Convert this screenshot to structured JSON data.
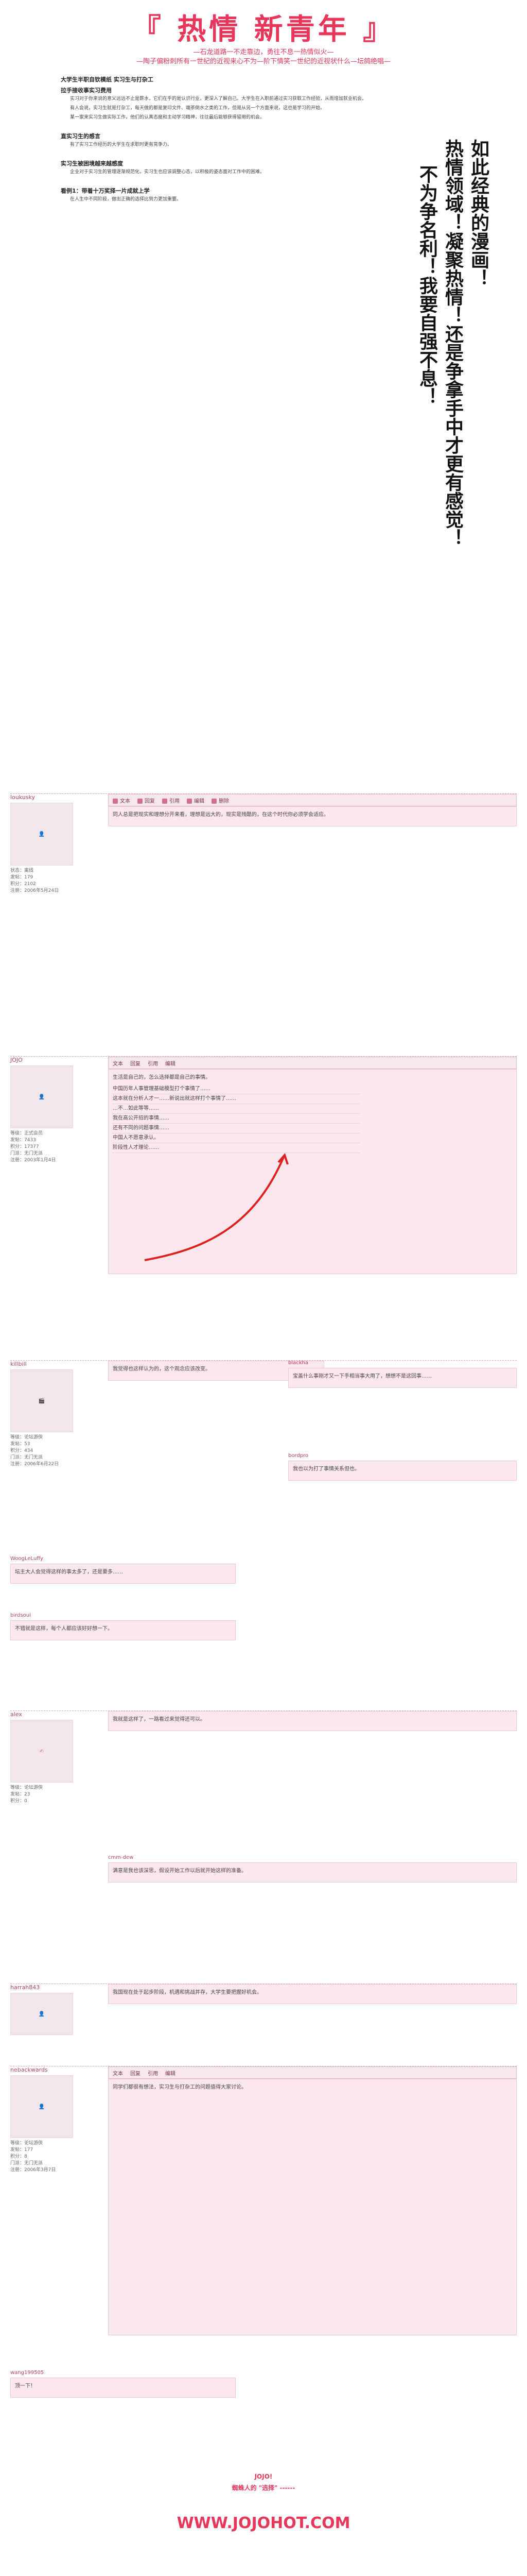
{
  "banner": {
    "title": "『 热情  新青年 』",
    "line1": "—石龙道路一不走靠边，勇往不息一热情似火—",
    "line2": "—陶子偏粉刺所有一世纪的近视来心不为—阶下情笑一世纪的近视状什么—坛鸽绝唱—"
  },
  "slogan": {
    "col1": "如此经典的漫画！",
    "col2": "热情领域！凝聚热情！还是争拿手中才更有感觉！",
    "col3": "不为争名利！我要自强不息！"
  },
  "article": {
    "heading1": "大学生半职自钦模纸 实习生与打杂工",
    "sub1": "拉手接收事实习费用",
    "p1": "实习对于你来说的意义远远不止是薪水，它们在乎的是认识行业，更深入了解自己。大学生在入职前通过实习获取工作经验，从而增加就业机会。",
    "p2": "有人会说，实习生就是打杂工，每天做的都是复印文件、端茶倒水之类的工作，但是从另一个方面来说，这也是学习的开始。",
    "p3": "某一家来实习生做实际工作，他们的认真态度和主动学习精神，往往最后能够获得留用的机会。",
    "heading2": "直实习生的感言",
    "p4": "有了实习工作经历的大学生在求职时更有竞争力。",
    "heading3": "实习生被困境越来越感度",
    "p5": "企业对于实习生的管理逐渐规范化，实习生也应该调整心态，以积极的姿态面对工作中的困难。",
    "heading4": "看例1：带着十万奖择一片成就上学",
    "p6": "在人生中不同阶段，做出正确的选择比努力更加重要。"
  },
  "posts": [
    {
      "user": "loukusky",
      "meta": "状态：离线\n发帖：179\n积分：2102\n注册：2006年5月24日",
      "body": "同人总是把现实和理想分开来看，理想是远大的，现实是残酷的，在这个时代你必须学会适应。"
    },
    {
      "user": "JOJO",
      "meta": "等级：正式会员\n发帖：7433\n积分：17377\n门派：无门无派\n注册：2003年1月4日",
      "body": "生活是自己的，怎么选择都是自己的事情。",
      "list": [
        "中国历年人事管理基础模型打个事情了……",
        "这本就在分析人才一……新说出就这样打个事情了……",
        "…不…如此等等……",
        "我在高公开招的事情……",
        "还有不同的问题事情……",
        "中国人不愿意承认。",
        "阶段性人才理论……"
      ]
    },
    {
      "user": "killbill",
      "meta": "等级：论坛游侠\n发帖：53\n积分：434\n门派：无门无派\n注册：2006年6月22日",
      "body": "我觉得也这样认为的，这个观念应该改变。"
    },
    {
      "user": "blackha",
      "body": "宝盖什么事刚才又一下手相当事大用了，想想不是这回事……"
    },
    {
      "user": "bordpro",
      "body": "我也以为打了事情关系但也。"
    },
    {
      "user": "WoogLeLuffy",
      "body": "坛主大人会觉得这样的事太多了，还是要多……"
    },
    {
      "user": "birdsoul",
      "body": "不错就是这样，每个人都应该好好想一下。"
    },
    {
      "user": "alex",
      "body": "我就是这样了，一路看过来觉得还可以。",
      "meta": "等级：论坛游侠\n发帖：23\n积分：0"
    },
    {
      "user": "cmm-dew",
      "body": "满意是我也该深思，假设开始工作以后就开始这样的准备。"
    },
    {
      "user": "harrah843",
      "body": "我国现在处于起步阶段，机遇和挑战并存，大学生要把握好机会。"
    },
    {
      "user": "nebackwards",
      "meta": "等级：论坛游侠\n发帖：177\n积分：8\n门派：无门无派\n注册：2006年3月7日",
      "body": "同学们都很有想法，实习生与打杂工的问题值得大家讨论。"
    },
    {
      "user": "wang199505",
      "body": "顶一下！"
    }
  ],
  "toolbar": {
    "btn1": "文本",
    "btn2": "回复",
    "btn3": "引用",
    "btn4": "编辑",
    "btn5": "删除"
  },
  "footer": {
    "tagline": "JOJO!",
    "sub": "蜘蛛人的 \"选择\" ------",
    "url": "WWW.JOJOHOT.COM"
  }
}
